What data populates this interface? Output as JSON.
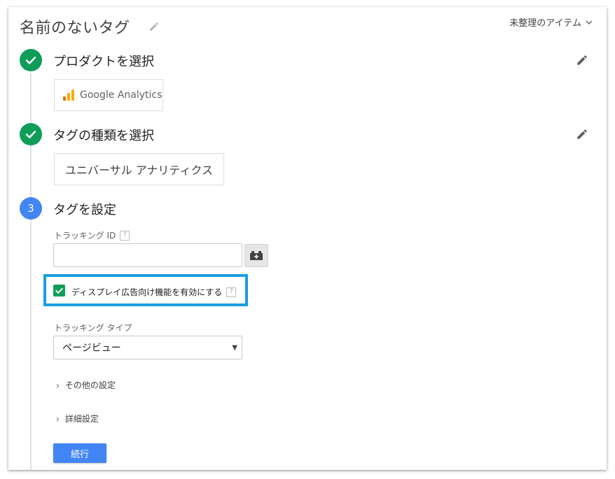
{
  "header": {
    "title": "名前のないタグ",
    "folder": "未整理のアイテム"
  },
  "steps": [
    {
      "title": "プロダクトを選択",
      "selection": "Google Analytics",
      "state": "done"
    },
    {
      "title": "タグの種類を選択",
      "selection": "ユニバーサル アナリティクス",
      "state": "done"
    },
    {
      "number": "3",
      "title": "タグを設定",
      "state": "current"
    }
  ],
  "config": {
    "tracking_id_label": "トラッキング ID",
    "tracking_id_value": "",
    "help_glyph": "?",
    "display_features_label": "ディスプレイ広告向け機能を有効にする",
    "display_features_checked": true,
    "tracking_type_label": "トラッキング タイプ",
    "tracking_type_value": "ページビュー",
    "more_settings": "その他の設定",
    "advanced_settings": "詳細設定",
    "continue_label": "続行"
  },
  "colors": {
    "done": "#0f9d58",
    "current": "#4285f4",
    "highlight": "#1a9ee0",
    "button": "#4285f4"
  }
}
